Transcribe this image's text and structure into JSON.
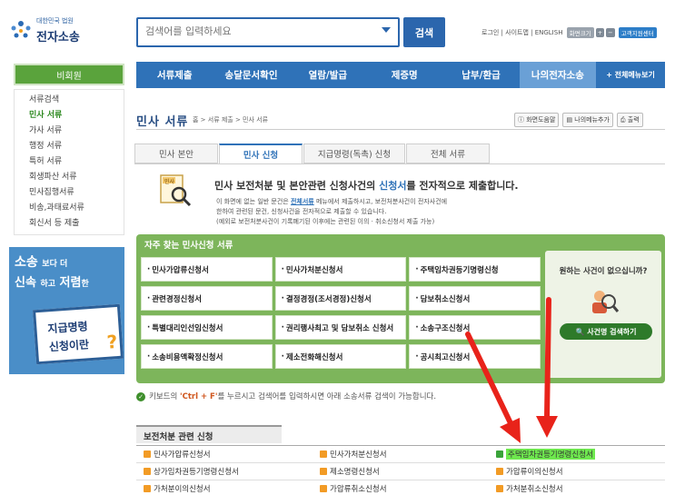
{
  "header": {
    "logo_sub": "대한민국 법원",
    "logo_main": "전자소송",
    "search_placeholder": "검색어를 입력하세요",
    "search_button": "검색",
    "top_links": "로그인 | 사이트맵 | ENGLISH",
    "font_label": "화면크기",
    "zoom_in": "+",
    "zoom_out": "−",
    "remote_support": "고객지원센터"
  },
  "nav": {
    "items": [
      "서류제출",
      "송달문서확인",
      "열람/발급",
      "제증명",
      "납부/환급",
      "나의전자소송",
      "+ 전체메뉴보기"
    ]
  },
  "sidebar": {
    "heading": "비회원",
    "items": [
      "서류검색",
      "민사 서류",
      "가사 서류",
      "행정 서류",
      "특허 서류",
      "회생파산 서류",
      "민사집행서류",
      "비송,과태료서류",
      "회신서 등 제출"
    ],
    "banner": {
      "line1a": "소송",
      "line1b": "보다 더",
      "line2a": "신속",
      "line2b": "하고",
      "line2c": "저렴",
      "line2d": "한",
      "card1": "지급명령",
      "card2": "신청이란",
      "card_q": "?"
    }
  },
  "page": {
    "title": "민사 서류",
    "breadcrumb": "홈 > 서류 제출 > 민사 서류",
    "tool_help": "화면도움말",
    "tool_mymenu": "나의메뉴추가",
    "tool_print": "출력"
  },
  "tabs": [
    "민사 본안",
    "민사 신청",
    "지급명령(독촉) 신청",
    "전체 서류"
  ],
  "intro": {
    "icon_label": "민사",
    "headline_pre": "민사 보전처분 및 본안관련 신청사건의 ",
    "headline_hl": "신청서",
    "headline_post": "를 전자적으로 제출합니다.",
    "line1_pre": "이 화면에 없는 일반 문건은 ",
    "line1_link": "전체서류",
    "line1_post": " 메뉴에서 제출하시고, 보전처분사건이 전자사건에",
    "line2": "한하여 관련된 문건, 신청사건을 전자적으로 제출할 수 있습니다.",
    "line3": "(예외로 보전처분사건이 기록폐기된 이후에는 관련된 이의 · 취소신청서 제출 가능)"
  },
  "frequent": {
    "title": "자주 찾는 민사신청 서류",
    "items": [
      "민사가압류신청서",
      "민사가처분신청서",
      "주택임차권등기명령신청",
      "관련경정신청서",
      "결정경정(조서경정)신청서",
      "담보취소신청서",
      "특별대리인선임신청서",
      "권리행사최고 및 담보취소 신청서",
      "소송구조신청서",
      "소송비용액확정신청서",
      "제소전화해신청서",
      "공시최고신청서"
    ],
    "side_question": "원하는 사건이 없으십니까?",
    "side_button": "사건명 검색하기"
  },
  "notice": {
    "pre": "키보드의 ",
    "key": "'Ctrl + F'",
    "post": "를 누르시고 검색어를 입력하시면 아래 소송서류 검색이 가능합니다."
  },
  "bottom": {
    "section_title": "보전처분 관련 신청",
    "rows": [
      [
        "민사가압류신청서",
        "민사가처분신청서",
        "주택임차권등기명령신청서"
      ],
      [
        "상가임차권등기명령신청서",
        "제소명령신청서",
        "가압류이의신청서"
      ],
      [
        "가처분이의신청서",
        "가압류취소신청서",
        "가처분취소신청서"
      ]
    ]
  },
  "colors": {
    "nav_blue": "#2f72b8",
    "sidebar_green": "#5aa33c",
    "freq_green": "#7db55b",
    "arrow_red": "#e8231a",
    "highlight_green": "#6ee84e"
  }
}
